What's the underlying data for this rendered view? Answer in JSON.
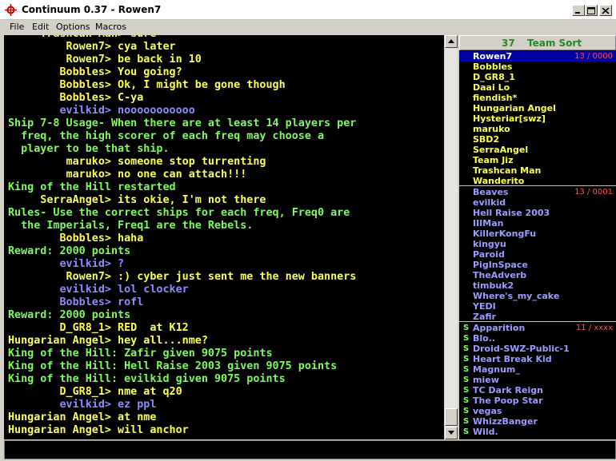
{
  "window": {
    "title": "Continuum 0.37 - Rowen7"
  },
  "menu": [
    "File",
    "Edit",
    "Options",
    "Macros"
  ],
  "colors": {
    "chat_green": "#7cfc5a",
    "chat_yellow": "#ffff50",
    "chat_periwinkle": "#8c8cff",
    "roster_yellow": "#ffff50",
    "roster_blue": "#9c9cff",
    "freq_red": "#ff5050",
    "selected_bg": "#0000a0"
  },
  "chat": [
    {
      "text": "     Trashcan Man> sure",
      "color": "#ffff50"
    },
    {
      "text": "         Rowen7> cya later",
      "color": "#ffff50"
    },
    {
      "text": "         Rowen7> be back in 10",
      "color": "#ffff50"
    },
    {
      "text": "        Bobbles> You going?",
      "color": "#ffff50"
    },
    {
      "text": "        Bobbles> Ok, I might be gone though",
      "color": "#ffff50"
    },
    {
      "text": "        Bobbles> C-ya",
      "color": "#ffff50"
    },
    {
      "text": "        evilkid> nooooooooooo",
      "color": "#8c8cff"
    },
    {
      "text": "Ship 7-8 Usage- When there are at least 14 players per",
      "color": "#7cfc5a"
    },
    {
      "text": "  freq, the high scorer of each freq may choose a",
      "color": "#7cfc5a"
    },
    {
      "text": "  player to be that ship.",
      "color": "#7cfc5a"
    },
    {
      "text": "         maruko> someone stop turrenting",
      "color": "#ffff50"
    },
    {
      "text": "         maruko> no one can attach!!!",
      "color": "#ffff50"
    },
    {
      "text": "King of the Hill restarted",
      "color": "#7cfc5a"
    },
    {
      "text": "     SerraAngel> its okie, I'm not there",
      "color": "#ffff50"
    },
    {
      "text": "Rules- Use the correct ships for each freq, Freq0 are",
      "color": "#7cfc5a"
    },
    {
      "text": "  the Imperials, Freq1 are the Rebels.",
      "color": "#7cfc5a"
    },
    {
      "text": "        Bobbles> haha",
      "color": "#ffff50"
    },
    {
      "text": "Reward: 2000 points",
      "color": "#7cfc5a"
    },
    {
      "text": "        evilkid> ?",
      "color": "#8c8cff"
    },
    {
      "text": "         Rowen7> :) cyber just sent me the new banners",
      "color": "#ffff50"
    },
    {
      "text": "        evilkid> lol clocker",
      "color": "#8c8cff"
    },
    {
      "text": "        Bobbles> rofl",
      "color": "#8c8cff"
    },
    {
      "text": "Reward: 2000 points",
      "color": "#7cfc5a"
    },
    {
      "text": "        D_GR8_1> RED  at K12",
      "color": "#ffff50"
    },
    {
      "text": "Hungarian Angel> hey all...nme?",
      "color": "#ffff50"
    },
    {
      "text": "King of the Hill: Zafir given 9075 points",
      "color": "#7cfc5a"
    },
    {
      "text": "King of the Hill: Hell Raise 2003 given 9075 points",
      "color": "#7cfc5a"
    },
    {
      "text": "King of the Hill: evilkid given 9075 points",
      "color": "#7cfc5a"
    },
    {
      "text": "        D_GR8_1> nme at q20",
      "color": "#ffff50"
    },
    {
      "text": "        evilkid> ez ppl",
      "color": "#8c8cff"
    },
    {
      "text": "Hungarian Angel> at nme",
      "color": "#ffff50"
    },
    {
      "text": "Hungarian Angel> will anchor",
      "color": "#ffff50"
    }
  ],
  "roster": {
    "count": "37",
    "sort_label": "Team Sort",
    "freqs": [
      {
        "meta": "13 / 0000",
        "color": "#ffff50",
        "spectator": false,
        "players": [
          "Rowen7",
          "Bobbles",
          "D_GR8_1",
          "Daai Lo",
          "fiendish*",
          "Hungarian Angel",
          "Hysteriar[swz]",
          "maruko",
          "SBD2",
          "SerraAngel",
          "Team Jiz",
          "Trashcan Man",
          "Wanderito"
        ]
      },
      {
        "meta": "13 / 0001",
        "color": "#9c9cff",
        "spectator": false,
        "players": [
          "Beaves",
          "evilkid",
          "Hell Raise 2003",
          "IIIMan",
          "KillerKongFu",
          "kingyu",
          "Paroid",
          "PigInSpace",
          "TheAdverb",
          "timbuk2",
          "Where's_my_cake",
          "YEDI",
          "Zafir"
        ]
      },
      {
        "meta": "11 / xxxx",
        "color": "#9c9cff",
        "spectator": true,
        "spec_mark": "S",
        "players": [
          "Apparition",
          "Blo..",
          "Droid-SWZ-Public-1",
          "Heart Break Kid",
          "Magnum_",
          "miew",
          "TC Dark Reign",
          "The Poop Star",
          "vegas",
          "WhizzBanger",
          "Wild."
        ]
      }
    ]
  }
}
